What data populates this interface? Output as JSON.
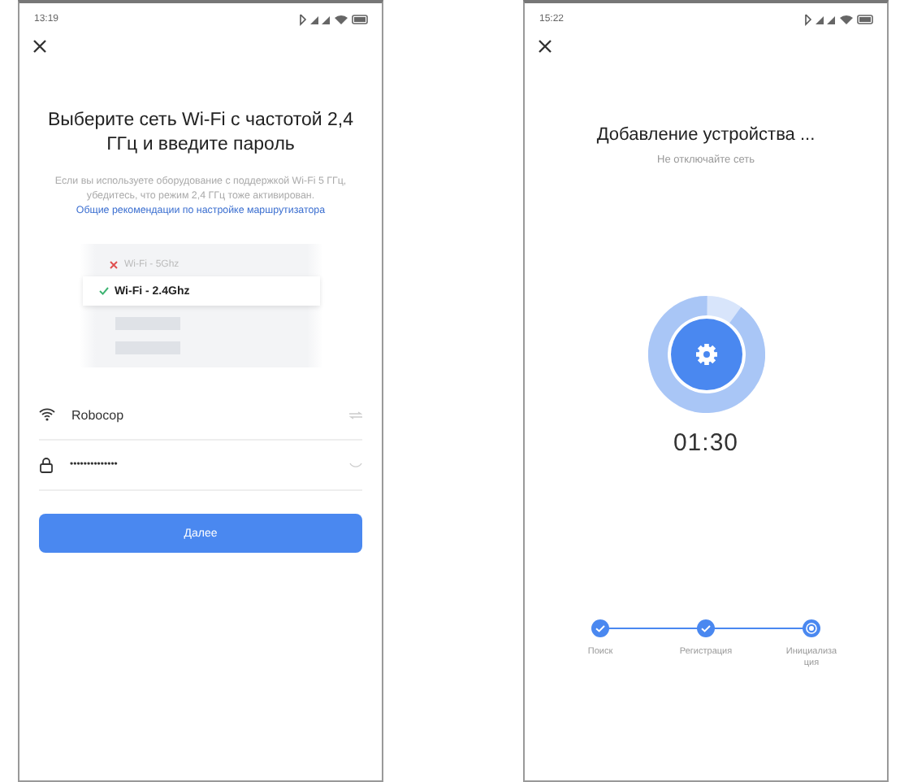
{
  "screens": [
    {
      "kind": "wifi_setup",
      "status_time": "13:19",
      "title": "Выберите сеть Wi-Fi с частотой 2,4 ГГц и введите пароль",
      "hint": "Если вы используете оборудование с поддержкой Wi-Fi 5 ГГц, убедитесь, что режим 2,4 ГГц тоже активирован.",
      "hint_link": "Общие рекомендации по настройке маршрутизатора",
      "networks": [
        {
          "label": "Wi-Fi - 5Ghz",
          "supported": false
        },
        {
          "label": "Wi-Fi - 2.4Ghz",
          "supported": true
        }
      ],
      "ssid_value": "Robocop",
      "password_value": "••••••••••••••",
      "next_button": "Далее"
    },
    {
      "kind": "adding",
      "status_time": "15:22",
      "title": "Добавление устройства ...",
      "subtitle": "Не отключайте сеть",
      "progress": {
        "level": 0.9
      },
      "timer": "01:30",
      "steps": [
        {
          "label": "Поиск",
          "done": true
        },
        {
          "label": "Регистрация",
          "done": true
        },
        {
          "label": "Инициализация",
          "done": false
        }
      ]
    }
  ]
}
